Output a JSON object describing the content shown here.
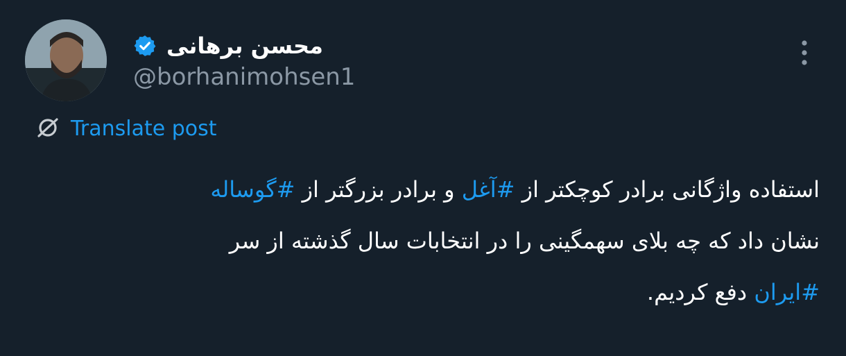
{
  "author": {
    "display_name": "محسن برهانی",
    "handle": "@borhanimohsen1",
    "verified": true
  },
  "icons": {
    "avatar": "profile-photo",
    "verified": "verified-badge-icon",
    "more": "more-vertical-icon",
    "translate": "translate-icon"
  },
  "translate_label": "Translate post",
  "post": {
    "line1": {
      "t1": "استفاده واژگانی برادر کوچکتر از ",
      "h1": "#آغل",
      "t2": " و برادر بزرگتر از ",
      "h2": "#گوساله"
    },
    "line2": {
      "t1": "نشان داد که چه بلای سهمگینی را در انتخابات سال گذشته از سر"
    },
    "line3": {
      "h1": "#ایران",
      "t1": " دفع کردیم."
    }
  },
  "colors": {
    "background": "#15202b",
    "text": "#ffffff",
    "secondary": "#8b98a5",
    "accent": "#1d9bf0"
  }
}
